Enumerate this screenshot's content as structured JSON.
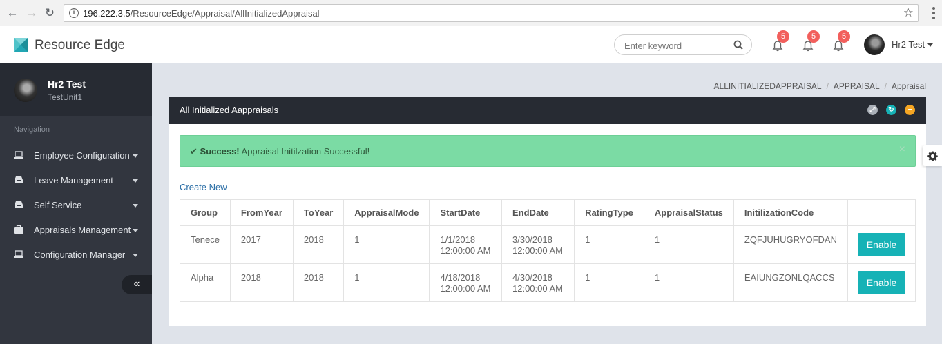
{
  "browser": {
    "url_host": "196.222.3.5",
    "url_path": "/ResourceEdge/Appraisal/AllInitializedAppraisal"
  },
  "header": {
    "brand": "Resource Edge",
    "search_placeholder": "Enter keyword",
    "notifications": [
      {
        "icon": "bell-icon",
        "count": "5"
      },
      {
        "icon": "bell-icon",
        "count": "5"
      },
      {
        "icon": "bell-icon",
        "count": "5"
      }
    ],
    "user_name": "Hr2 Test",
    "badge_color": "#f25f5c"
  },
  "sidebar": {
    "profile_name": "Hr2 Test",
    "profile_unit": "TestUnit1",
    "nav_label": "Navigation",
    "items": [
      {
        "label": "Employee Configuration",
        "icon": "laptop-icon"
      },
      {
        "label": "Leave Management",
        "icon": "inbox-icon"
      },
      {
        "label": "Self Service",
        "icon": "inbox-icon"
      },
      {
        "label": "Appraisals Management",
        "icon": "briefcase-icon"
      },
      {
        "label": "Configuration Manager",
        "icon": "laptop-icon"
      }
    ],
    "collapse_glyph": "«"
  },
  "breadcrumb": [
    "ALLINITIALIZEDAPPRAISAL",
    "APPRAISAL",
    "Appraisal"
  ],
  "panel": {
    "title": "All Initialized Aappraisals",
    "alert_strong": "Success!",
    "alert_message": "Appraisal Initilzation Successful!",
    "alert_color": "#7bdba4",
    "create_new": "Create New",
    "columns": [
      "Group",
      "FromYear",
      "ToYear",
      "AppraisalMode",
      "StartDate",
      "EndDate",
      "RatingType",
      "AppraisalStatus",
      "InitilizationCode"
    ],
    "rows": [
      {
        "group": "Tenece",
        "from": "2017",
        "to": "2018",
        "mode": "1",
        "start_date": "1/1/2018",
        "start_time": "12:00:00 AM",
        "end_date": "3/30/2018",
        "end_time": "12:00:00 AM",
        "rating": "1",
        "status": "1",
        "code": "ZQFJUHUGRYOFDAN",
        "action": "Enable"
      },
      {
        "group": "Alpha",
        "from": "2018",
        "to": "2018",
        "mode": "1",
        "start_date": "4/18/2018",
        "start_time": "12:00:00 AM",
        "end_date": "4/30/2018",
        "end_time": "12:00:00 AM",
        "rating": "1",
        "status": "1",
        "code": "EAIUNGZONLQACCS",
        "action": "Enable"
      }
    ],
    "button_color": "#16b2b6"
  }
}
